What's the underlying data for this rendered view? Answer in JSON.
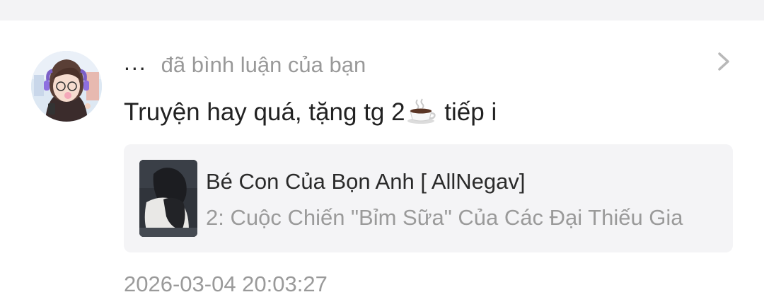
{
  "notification": {
    "username": "...",
    "action": "đã bình luận của bạn",
    "comment": {
      "before_icon": "Truyện hay quá, tặng tg 2",
      "icon": "coffee-cup-icon",
      "after_icon": " tiếp i"
    },
    "story": {
      "title": "Bé Con Của Bọn Anh [ AllNegav]",
      "chapter": "2: Cuộc Chiến \"Bỉm Sữa\" Của Các Đại Thiếu Gia"
    },
    "timestamp": "2026-03-04 20:03:27"
  },
  "colors": {
    "background": "#ffffff",
    "top_band": "#f3f3f5",
    "story_card": "#f4f4f6",
    "text_primary": "#222222",
    "text_secondary": "#999999"
  }
}
